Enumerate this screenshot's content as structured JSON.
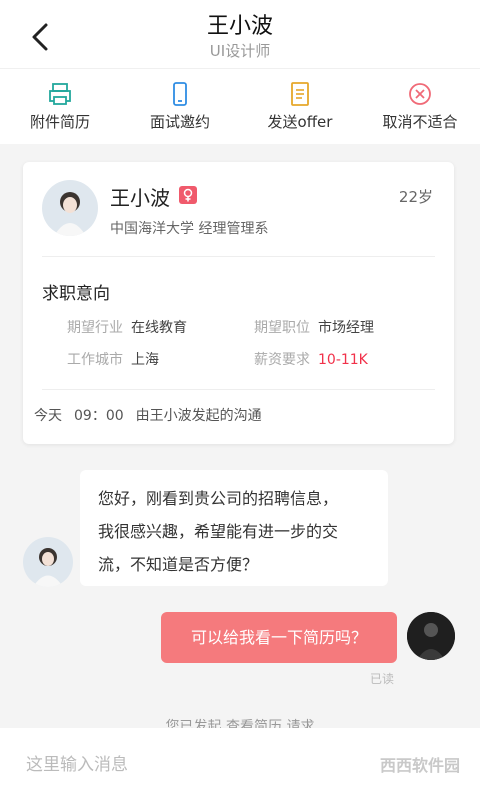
{
  "header": {
    "title": "王小波",
    "subtitle": "UI设计师",
    "back_icon": "chevron-left-icon"
  },
  "actions": [
    {
      "label": "附件简历",
      "icon": "printer-icon",
      "color": "#22a79c"
    },
    {
      "label": "面试邀约",
      "icon": "phone-icon",
      "color": "#2f8de4"
    },
    {
      "label": "发送offer",
      "icon": "document-icon",
      "color": "#e6a72a"
    },
    {
      "label": "取消不适合",
      "icon": "close-circle-icon",
      "color": "#f06a77"
    }
  ],
  "profile": {
    "name": "王小波",
    "gender_icon": "female-icon",
    "age": "22岁",
    "education": "中国海洋大学   经理管理系",
    "intent_title": "求职意向",
    "fields": {
      "industry_key": "期望行业",
      "industry_value": "在线教育",
      "position_key": "期望职位",
      "position_value": "市场经理",
      "city_key": "工作城市",
      "city_value": "上海",
      "salary_key": "薪资要求",
      "salary_value": "10-11K"
    },
    "conversation": {
      "day": "今天",
      "time": "09：00",
      "desc": "由王小波发起的沟通"
    }
  },
  "messages": {
    "incoming_lines": [
      "您好，刚看到贵公司的招聘信息，",
      "我很感兴趣，希望能有进一步的交",
      "流，不知道是否方便？"
    ],
    "outgoing": "可以给我看一下简历吗？",
    "read_status": "已读",
    "system_note": "您已发起 查看简历 请求"
  },
  "input": {
    "placeholder": "这里输入消息"
  },
  "watermark": "西西软件园"
}
